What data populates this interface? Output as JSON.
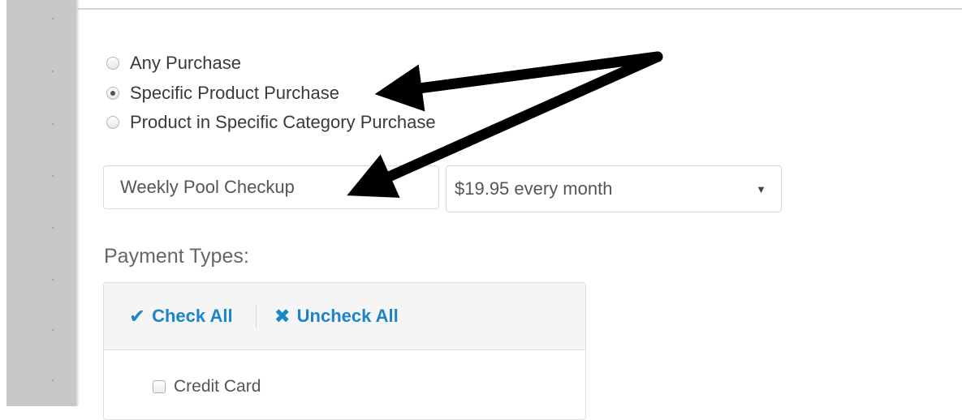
{
  "purchase_options": [
    {
      "label": "Any Purchase",
      "checked": false
    },
    {
      "label": "Specific Product Purchase",
      "checked": true
    },
    {
      "label": "Product in Specific Category Purchase",
      "checked": false
    }
  ],
  "product_input": {
    "value": "Weekly Pool Checkup"
  },
  "price_select": {
    "selected": "$19.95 every month",
    "arrow_glyph": "▼"
  },
  "payment_types": {
    "label": "Payment Types:",
    "check_all": "Check All",
    "check_all_glyph": "✔",
    "uncheck_all": "Uncheck All",
    "uncheck_all_glyph": "✖",
    "items": [
      {
        "label": "Credit Card",
        "checked": false
      }
    ]
  },
  "colors": {
    "link_blue": "#1a85c8",
    "gutter_gray": "#c8c8c8",
    "annotation_arrows": "#000000"
  }
}
